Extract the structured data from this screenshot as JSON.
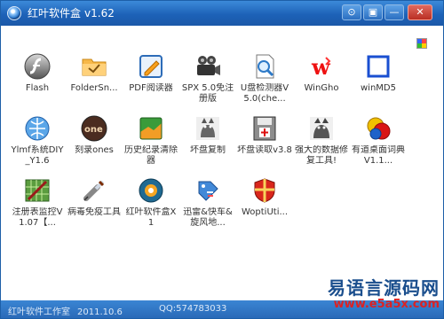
{
  "window": {
    "title": "红叶软件盒",
    "version": "v1.62"
  },
  "title_buttons": {
    "skin": "⊙",
    "menu": "▣",
    "minimize": "—",
    "close": "✕"
  },
  "items": [
    {
      "label": "Flash",
      "icon": "flash-icon"
    },
    {
      "label": "FolderSn...",
      "icon": "folder-icon"
    },
    {
      "label": "PDF阅读器",
      "icon": "pdf-reader-icon"
    },
    {
      "label": "SPX 5.0免注册版",
      "icon": "camera-icon"
    },
    {
      "label": "U盘检测器V5.0(che...",
      "icon": "usb-checker-icon"
    },
    {
      "label": "WinGho",
      "icon": "winghost-icon"
    },
    {
      "label": "winMD5",
      "icon": "winmd5-icon"
    },
    {
      "label": "Ylmf系统DIY_Y1.6",
      "icon": "ylmf-icon"
    },
    {
      "label": "刻录ones",
      "icon": "ones-icon"
    },
    {
      "label": "历史纪录清除器",
      "icon": "history-cleaner-icon"
    },
    {
      "label": "坏盘复制",
      "icon": "cat-icon"
    },
    {
      "label": "坏盘读取v3.8",
      "icon": "disk-reader-icon"
    },
    {
      "label": "强大的数据修复工具!",
      "icon": "cat-data-icon"
    },
    {
      "label": "有道桌面词典 V1.1...",
      "icon": "youdao-icon"
    },
    {
      "label": "注册表监控V1.07【...",
      "icon": "registry-icon"
    },
    {
      "label": "病毒免疫工具",
      "icon": "syringe-icon"
    },
    {
      "label": "红叶软件盒X1",
      "icon": "hongye-box-icon"
    },
    {
      "label": "迅雷&快车&旋风地...",
      "icon": "tag-icon"
    },
    {
      "label": "WoptiUti...",
      "icon": "shield-icon"
    }
  ],
  "status": {
    "company": "红叶软件工作室",
    "date": "2011.10.6",
    "qq": "QQ:574783033"
  },
  "watermark": {
    "title": "易语言源码网",
    "url": "www.e5a5x.com"
  }
}
